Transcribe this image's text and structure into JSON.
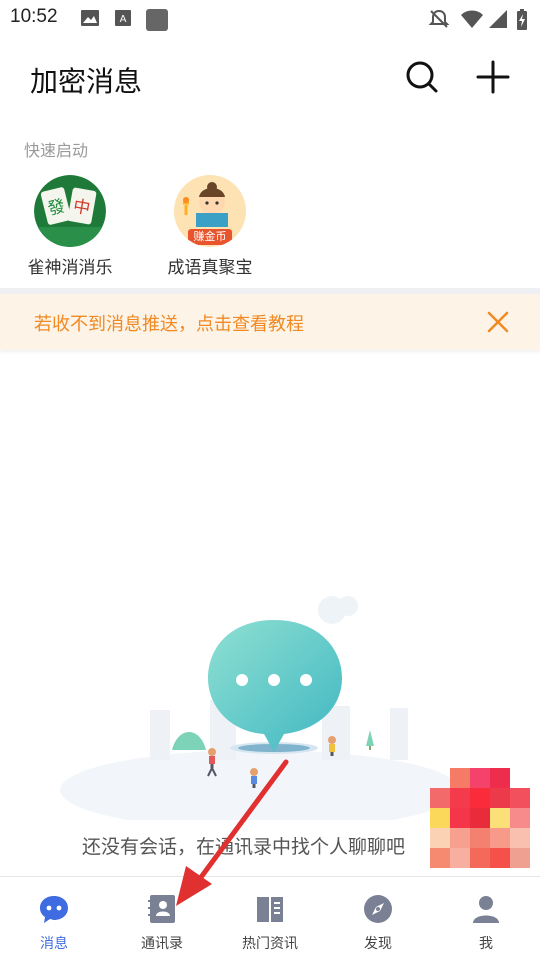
{
  "status_bar": {
    "time": "10:52",
    "icons": [
      "image-icon",
      "text-icon",
      "app-icon",
      "bell-off-icon",
      "wifi-icon",
      "signal-icon",
      "battery-charging-icon"
    ]
  },
  "header": {
    "title": "加密消息",
    "actions": [
      "search-icon",
      "plus-icon"
    ]
  },
  "quick_launch": {
    "label": "快速启动",
    "apps": [
      {
        "name": "雀神消消乐",
        "icon": "mahjong-icon"
      },
      {
        "name": "成语真聚宝",
        "icon": "idiom-treasure-icon",
        "badge_text": "赚金币"
      }
    ]
  },
  "notice": {
    "text": "若收不到消息推送，点击查看教程",
    "close_icon": "close-icon",
    "color": "#f08a24"
  },
  "empty_state": {
    "text": "还没有会话，在通讯录中找个人聊聊吧"
  },
  "tabs": [
    {
      "label": "消息",
      "icon": "chat-bubble-icon",
      "active": true
    },
    {
      "label": "通讯录",
      "icon": "contacts-icon",
      "active": false
    },
    {
      "label": "热门资讯",
      "icon": "book-icon",
      "active": false
    },
    {
      "label": "发现",
      "icon": "compass-icon",
      "active": false
    },
    {
      "label": "我",
      "icon": "user-icon",
      "active": false
    }
  ],
  "colors": {
    "accent": "#3f6ce0",
    "notice_bg": "#fdf3e6",
    "arrow": "#e0302f"
  }
}
